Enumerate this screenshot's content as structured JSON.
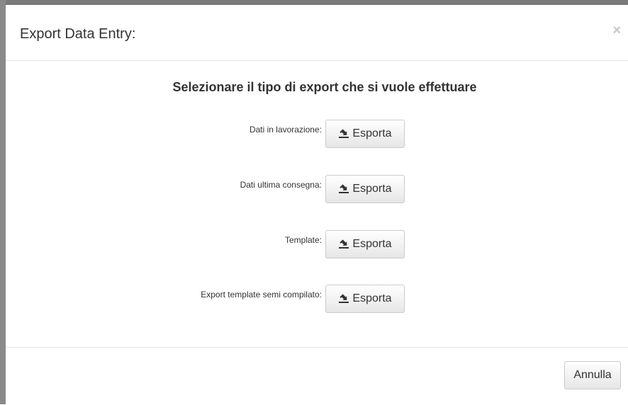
{
  "modal": {
    "title": "Export Data Entry:",
    "close_symbol": "×",
    "heading": "Selezionare il tipo di export che si vuole effettuare",
    "rows": [
      {
        "label": "Dati in lavorazione:",
        "button_label": "Esporta",
        "icon": "export-icon"
      },
      {
        "label": "Dati ultima consegna:",
        "button_label": "Esporta",
        "icon": "export-icon"
      },
      {
        "label": "Template:",
        "button_label": "Esporta",
        "icon": "export-icon"
      },
      {
        "label": "Export template semi compilato:",
        "button_label": "Esporta",
        "icon": "export-icon"
      }
    ],
    "cancel_label": "Annulla"
  }
}
